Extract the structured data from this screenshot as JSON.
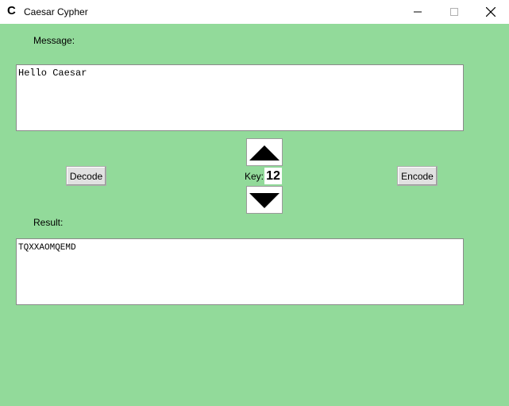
{
  "window": {
    "title": "Caesar Cypher",
    "icon": "C"
  },
  "message": {
    "label": "Message:",
    "value": "Hello Caesar"
  },
  "controls": {
    "decode_label": "Decode",
    "encode_label": "Encode",
    "key_label": "Key:",
    "key_value": "12"
  },
  "result": {
    "label": "Result:",
    "value": "TQXXAOMQEMD"
  },
  "colors": {
    "background": "#92da9a",
    "titlebar": "#ffffff"
  }
}
